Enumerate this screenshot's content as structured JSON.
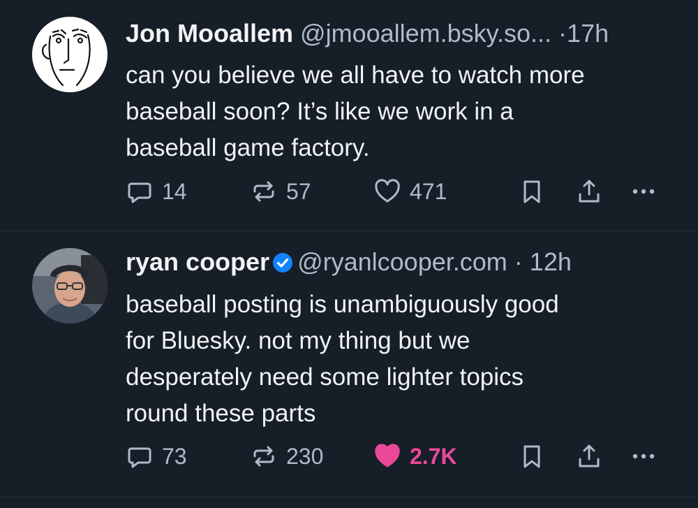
{
  "posts": [
    {
      "author_name": "Jon Mooallem",
      "handle": "@jmooallem.bsky.so...",
      "separator": "·",
      "time": "17h",
      "text_lines": [
        "can you believe we all have to watch more",
        "baseball soon? It’s like we work in a",
        "baseball game factory."
      ],
      "replies": "14",
      "reposts": "57",
      "likes": "471",
      "liked": false,
      "verified": false
    },
    {
      "author_name": "ryan cooper",
      "handle": "@ryanlcooper.com",
      "separator": "·",
      "time": "12h",
      "text_lines": [
        "baseball posting is unambiguously good",
        "for Bluesky. not my thing but we",
        "desperately need some lighter topics",
        "round these parts"
      ],
      "replies": "73",
      "reposts": "230",
      "likes": "2.7K",
      "liked": true,
      "verified": true
    }
  ],
  "icons": {
    "reply": "reply-icon",
    "repost": "repost-icon",
    "like": "heart-icon",
    "bookmark": "bookmark-icon",
    "share": "share-icon",
    "more": "more-icon",
    "verified": "verified-badge-icon"
  },
  "colors": {
    "background": "#161e27",
    "muted": "#aebbc9",
    "like_active": "#ec4899",
    "verified": "#1083fe"
  }
}
